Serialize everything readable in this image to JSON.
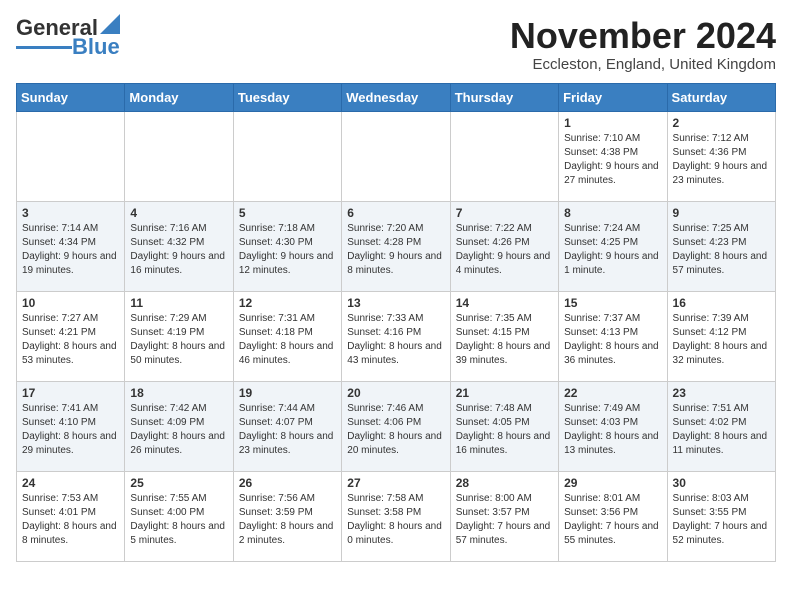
{
  "logo": {
    "text1": "General",
    "text2": "Blue"
  },
  "header": {
    "month": "November 2024",
    "location": "Eccleston, England, United Kingdom"
  },
  "days_of_week": [
    "Sunday",
    "Monday",
    "Tuesday",
    "Wednesday",
    "Thursday",
    "Friday",
    "Saturday"
  ],
  "weeks": [
    [
      {
        "day": "",
        "info": ""
      },
      {
        "day": "",
        "info": ""
      },
      {
        "day": "",
        "info": ""
      },
      {
        "day": "",
        "info": ""
      },
      {
        "day": "",
        "info": ""
      },
      {
        "day": "1",
        "info": "Sunrise: 7:10 AM\nSunset: 4:38 PM\nDaylight: 9 hours and 27 minutes."
      },
      {
        "day": "2",
        "info": "Sunrise: 7:12 AM\nSunset: 4:36 PM\nDaylight: 9 hours and 23 minutes."
      }
    ],
    [
      {
        "day": "3",
        "info": "Sunrise: 7:14 AM\nSunset: 4:34 PM\nDaylight: 9 hours and 19 minutes."
      },
      {
        "day": "4",
        "info": "Sunrise: 7:16 AM\nSunset: 4:32 PM\nDaylight: 9 hours and 16 minutes."
      },
      {
        "day": "5",
        "info": "Sunrise: 7:18 AM\nSunset: 4:30 PM\nDaylight: 9 hours and 12 minutes."
      },
      {
        "day": "6",
        "info": "Sunrise: 7:20 AM\nSunset: 4:28 PM\nDaylight: 9 hours and 8 minutes."
      },
      {
        "day": "7",
        "info": "Sunrise: 7:22 AM\nSunset: 4:26 PM\nDaylight: 9 hours and 4 minutes."
      },
      {
        "day": "8",
        "info": "Sunrise: 7:24 AM\nSunset: 4:25 PM\nDaylight: 9 hours and 1 minute."
      },
      {
        "day": "9",
        "info": "Sunrise: 7:25 AM\nSunset: 4:23 PM\nDaylight: 8 hours and 57 minutes."
      }
    ],
    [
      {
        "day": "10",
        "info": "Sunrise: 7:27 AM\nSunset: 4:21 PM\nDaylight: 8 hours and 53 minutes."
      },
      {
        "day": "11",
        "info": "Sunrise: 7:29 AM\nSunset: 4:19 PM\nDaylight: 8 hours and 50 minutes."
      },
      {
        "day": "12",
        "info": "Sunrise: 7:31 AM\nSunset: 4:18 PM\nDaylight: 8 hours and 46 minutes."
      },
      {
        "day": "13",
        "info": "Sunrise: 7:33 AM\nSunset: 4:16 PM\nDaylight: 8 hours and 43 minutes."
      },
      {
        "day": "14",
        "info": "Sunrise: 7:35 AM\nSunset: 4:15 PM\nDaylight: 8 hours and 39 minutes."
      },
      {
        "day": "15",
        "info": "Sunrise: 7:37 AM\nSunset: 4:13 PM\nDaylight: 8 hours and 36 minutes."
      },
      {
        "day": "16",
        "info": "Sunrise: 7:39 AM\nSunset: 4:12 PM\nDaylight: 8 hours and 32 minutes."
      }
    ],
    [
      {
        "day": "17",
        "info": "Sunrise: 7:41 AM\nSunset: 4:10 PM\nDaylight: 8 hours and 29 minutes."
      },
      {
        "day": "18",
        "info": "Sunrise: 7:42 AM\nSunset: 4:09 PM\nDaylight: 8 hours and 26 minutes."
      },
      {
        "day": "19",
        "info": "Sunrise: 7:44 AM\nSunset: 4:07 PM\nDaylight: 8 hours and 23 minutes."
      },
      {
        "day": "20",
        "info": "Sunrise: 7:46 AM\nSunset: 4:06 PM\nDaylight: 8 hours and 20 minutes."
      },
      {
        "day": "21",
        "info": "Sunrise: 7:48 AM\nSunset: 4:05 PM\nDaylight: 8 hours and 16 minutes."
      },
      {
        "day": "22",
        "info": "Sunrise: 7:49 AM\nSunset: 4:03 PM\nDaylight: 8 hours and 13 minutes."
      },
      {
        "day": "23",
        "info": "Sunrise: 7:51 AM\nSunset: 4:02 PM\nDaylight: 8 hours and 11 minutes."
      }
    ],
    [
      {
        "day": "24",
        "info": "Sunrise: 7:53 AM\nSunset: 4:01 PM\nDaylight: 8 hours and 8 minutes."
      },
      {
        "day": "25",
        "info": "Sunrise: 7:55 AM\nSunset: 4:00 PM\nDaylight: 8 hours and 5 minutes."
      },
      {
        "day": "26",
        "info": "Sunrise: 7:56 AM\nSunset: 3:59 PM\nDaylight: 8 hours and 2 minutes."
      },
      {
        "day": "27",
        "info": "Sunrise: 7:58 AM\nSunset: 3:58 PM\nDaylight: 8 hours and 0 minutes."
      },
      {
        "day": "28",
        "info": "Sunrise: 8:00 AM\nSunset: 3:57 PM\nDaylight: 7 hours and 57 minutes."
      },
      {
        "day": "29",
        "info": "Sunrise: 8:01 AM\nSunset: 3:56 PM\nDaylight: 7 hours and 55 minutes."
      },
      {
        "day": "30",
        "info": "Sunrise: 8:03 AM\nSunset: 3:55 PM\nDaylight: 7 hours and 52 minutes."
      }
    ]
  ]
}
